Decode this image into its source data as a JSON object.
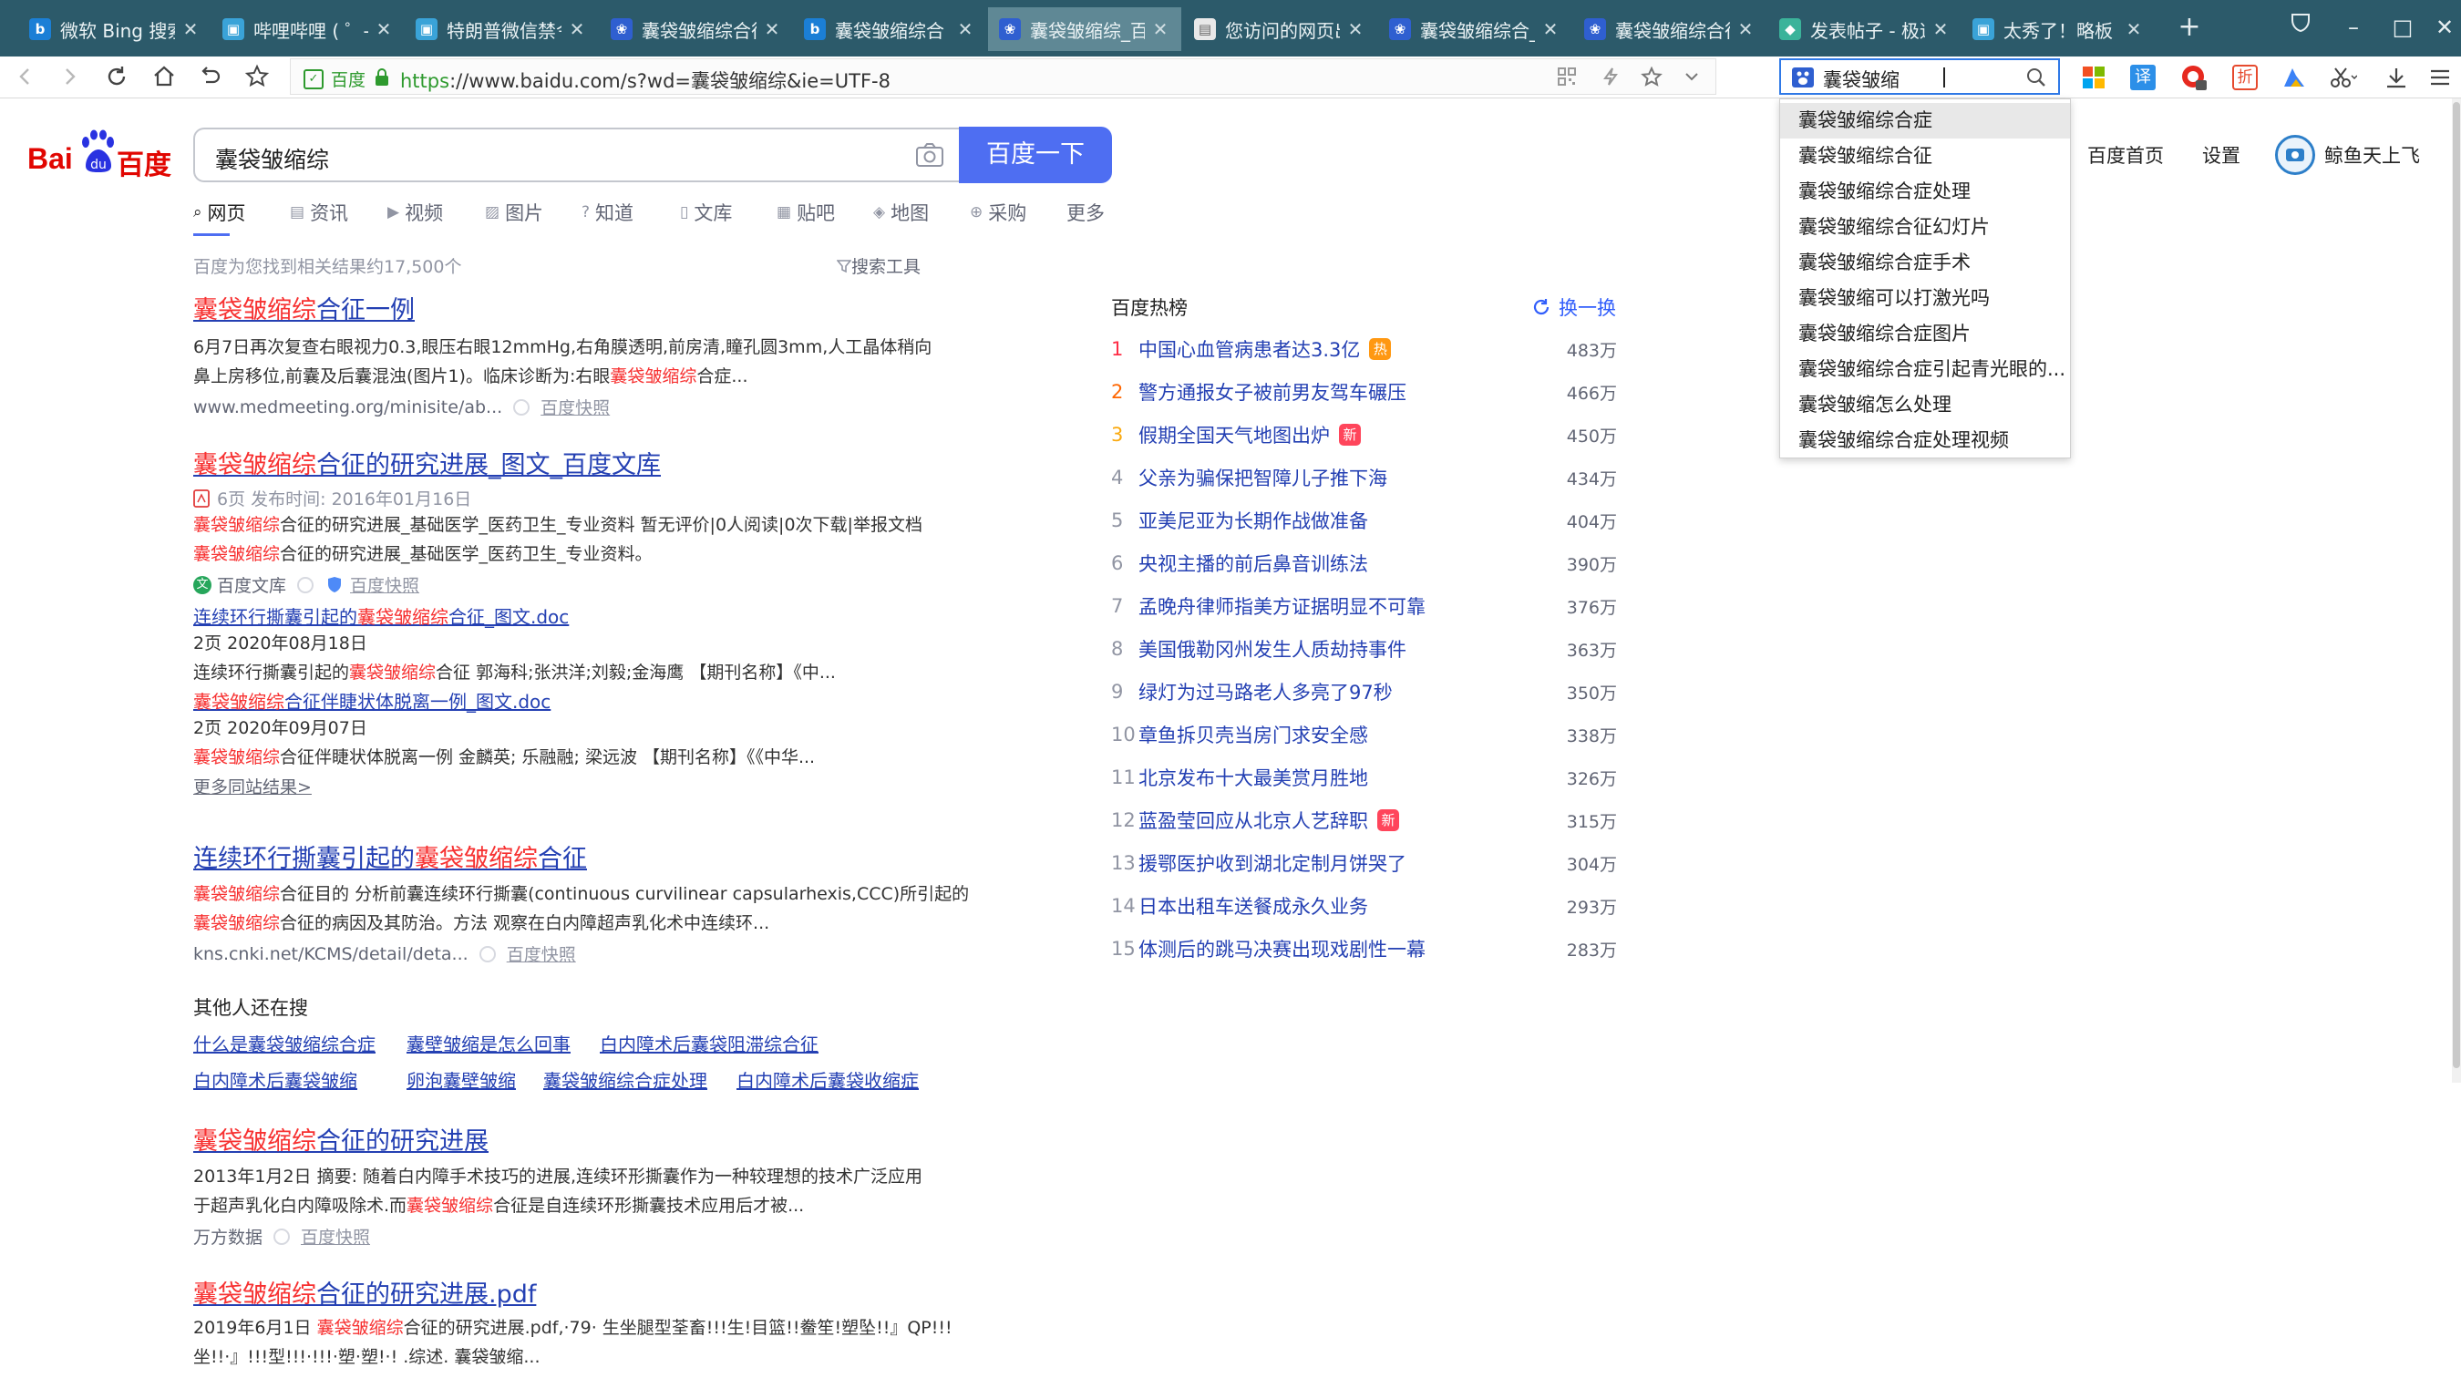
{
  "tabs": [
    {
      "title": "微软 Bing 搜索",
      "icon": "bing-icon",
      "color": "#1b7fd6"
    },
    {
      "title": "哔哩哔哩 ( ゜- ゜",
      "icon": "bilibili-icon",
      "color": "#3aa3d8"
    },
    {
      "title": "特朗普微信禁令",
      "icon": "bilibili-icon",
      "color": "#3aa3d8"
    },
    {
      "title": "囊袋皱缩综合征",
      "icon": "baidu-icon",
      "color": "#2f5fd0"
    },
    {
      "title": "囊袋皱缩综合",
      "icon": "bing-icon",
      "color": "#1b7fd6"
    },
    {
      "title": "囊袋皱缩综_百度",
      "icon": "baidu-icon",
      "color": "#2f5fd0",
      "active": true
    },
    {
      "title": "您访问的网页出",
      "icon": "page-icon",
      "color": "#e8e8e8"
    },
    {
      "title": "囊袋皱缩综合_",
      "icon": "baidu-icon",
      "color": "#2f5fd0"
    },
    {
      "title": "囊袋皱缩综合征",
      "icon": "baidu-icon",
      "color": "#2f5fd0"
    },
    {
      "title": "发表帖子 - 极速",
      "icon": "forum-icon",
      "color": "#3bb39a"
    },
    {
      "title": "太秀了！略板",
      "icon": "bilibili-icon",
      "color": "#3aa3d8"
    }
  ],
  "toolbar": {
    "site_badge": "百度",
    "url_https": "https",
    "url_rest": "://www.baidu.com/s?wd=囊袋皱缩综&ie=UTF-8",
    "search_value": "囊袋皱缩"
  },
  "suggestions": [
    "囊袋皱缩综合症",
    "囊袋皱缩综合征",
    "囊袋皱缩综合症处理",
    "囊袋皱缩综合征幻灯片",
    "囊袋皱缩综合症手术",
    "囊袋皱缩可以打激光吗",
    "囊袋皱缩综合症图片",
    "囊袋皱缩综合症引起青光眼的...",
    "囊袋皱缩怎么处理",
    "囊袋皱缩综合症处理视频"
  ],
  "page": {
    "logo_text_left": "Bai",
    "logo_text_right": "百度",
    "query": "囊袋皱缩综",
    "search_button": "百度一下",
    "home_link": "百度首页",
    "settings_link": "设置",
    "username": "鲸鱼天上飞",
    "nav": [
      "网页",
      "资讯",
      "视频",
      "图片",
      "知道",
      "文库",
      "贴吧",
      "地图",
      "采购",
      "更多"
    ],
    "result_count": "百度为您找到相关结果约17,500个",
    "search_tools": "搜索工具"
  },
  "results": {
    "r1": {
      "title_em": "囊袋皱缩综",
      "title_rest": "合征一例",
      "desc1": "6月7日再次复查右眼视力0.3,眼压右眼12mmHg,右角膜透明,前房清,瞳孔圆3mm,人工晶体稍向",
      "desc2a": "鼻上房移位,前囊及后囊混浊(图片1)。临床诊断为:右眼",
      "desc2em": "囊袋皱缩综",
      "desc2b": "合症...",
      "url": "www.medmeeting.org/minisite/ab...",
      "snapshot": "百度快照"
    },
    "r2": {
      "title_em": "囊袋皱缩综",
      "title_rest": "合征的研究进展_图文_百度文库",
      "meta": "6页 发布时间: 2016年01月16日",
      "desc1em": "囊袋皱缩综",
      "desc1": "合征的研究进展_基础医学_医药卫生_专业资料 暂无评价|0人阅读|0次下载|举报文档",
      "desc2em": "囊袋皱缩综",
      "desc2": "合征的研究进展_基础医学_医药卫生_专业资料。",
      "source": "百度文库",
      "snapshot": "百度快照",
      "sub1_a": "连续环行撕囊引起的",
      "sub1_em": "囊袋皱缩综",
      "sub1_b": "合征_图文.doc",
      "sub1_meta": "2页  2020年08月18日",
      "sub1_desc_a": "连续环行撕囊引起的",
      "sub1_desc_em": "囊袋皱缩综",
      "sub1_desc_b": "合征 郭海科;张洪洋;刘毅;金海鹰 【期刊名称】《中...",
      "sub2_em": "囊袋皱缩综",
      "sub2_b": "合征伴睫状体脱离一例_图文.doc",
      "sub2_meta": "2页  2020年09月07日",
      "sub2_desc_em": "囊袋皱缩综",
      "sub2_desc_b": "合征伴睫状体脱离一例 金麟英; 乐融融; 梁远波 【期刊名称】《《中华...",
      "more": "更多同站结果>"
    },
    "r3": {
      "title_a": "连续环行撕囊引起的",
      "title_em": "囊袋皱缩综",
      "title_b": "合征",
      "desc1": "目的 分析前囊连续环行撕囊(continuous curvilinear capsularhexis,CCC)所引起的",
      "desc1em": "囊袋皱缩综",
      "desc1b": "合征",
      "desc2em": "囊袋皱缩综",
      "desc2": "合征的病因及其防治。方法 观察在白内障超声乳化术中连续环...",
      "url": "kns.cnki.net/KCMS/detail/deta...",
      "snapshot": "百度快照"
    },
    "related_title": "其他人还在搜",
    "related": [
      "什么是囊袋皱缩综合症",
      "囊壁皱缩是怎么回事",
      "白内障术后囊袋阻滞综合征",
      "白内障术后囊袋皱缩",
      "卵泡囊壁皱缩",
      "囊袋皱缩综合症处理",
      "白内障术后囊袋收缩症"
    ],
    "r4": {
      "title_em": "囊袋皱缩综",
      "title_rest": "合征的研究进展",
      "desc1": "2013年1月2日 摘要: 随着白内障手术技巧的进展,连续环形撕囊作为一种较理想的技术广泛应用",
      "desc2a": "于超声乳化白内障吸除术.而",
      "desc2em": "囊袋皱缩综",
      "desc2b": "合征是自连续环形撕囊技术应用后才被...",
      "source": "万方数据",
      "snapshot": "百度快照"
    },
    "r5": {
      "title_em": "囊袋皱缩综",
      "title_rest": "合征的研究进展.pdf",
      "desc1a": "2019年6月1日 ",
      "desc1em": "囊袋皱缩综",
      "desc1b": "合征的研究进展.pdf,·79· 生坐腿型荃畜!!!生!目篮!!鲞笙!塑坠!!』QP!!!",
      "desc2": "坐!!·』!!!型!!!·!!!·塑·塑!·! .综述. 囊袋皱缩..."
    }
  },
  "hot": {
    "title": "百度热榜",
    "refresh": "换一换",
    "items": [
      {
        "rank": "1",
        "text": "中国心血管病患者达3.3亿",
        "tag": "热",
        "tag_color": "#ff9812",
        "count": "483万",
        "rank_color": "#fe2d46"
      },
      {
        "rank": "2",
        "text": "警方通报女子被前男友驾车碾压",
        "tag": "",
        "count": "466万",
        "rank_color": "#f60"
      },
      {
        "rank": "3",
        "text": "假期全国天气地图出炉",
        "tag": "新",
        "tag_color": "#ff455b",
        "count": "450万",
        "rank_color": "#faa90e"
      },
      {
        "rank": "4",
        "text": "父亲为骗保把智障儿子推下海",
        "tag": "",
        "count": "434万"
      },
      {
        "rank": "5",
        "text": "亚美尼亚为长期作战做准备",
        "tag": "",
        "count": "404万"
      },
      {
        "rank": "6",
        "text": "央视主播的前后鼻音训练法",
        "tag": "",
        "count": "390万"
      },
      {
        "rank": "7",
        "text": "孟晚舟律师指美方证据明显不可靠",
        "tag": "",
        "count": "376万"
      },
      {
        "rank": "8",
        "text": "美国俄勒冈州发生人质劫持事件",
        "tag": "",
        "count": "363万"
      },
      {
        "rank": "9",
        "text": "绿灯为过马路老人多亮了97秒",
        "tag": "",
        "count": "350万"
      },
      {
        "rank": "10",
        "text": "章鱼拆贝壳当房门求安全感",
        "tag": "",
        "count": "338万"
      },
      {
        "rank": "11",
        "text": "北京发布十大最美赏月胜地",
        "tag": "",
        "count": "326万"
      },
      {
        "rank": "12",
        "text": "蓝盈莹回应从北京人艺辞职",
        "tag": "新",
        "tag_color": "#ff455b",
        "count": "315万"
      },
      {
        "rank": "13",
        "text": "援鄂医护收到湖北定制月饼哭了",
        "tag": "",
        "count": "304万"
      },
      {
        "rank": "14",
        "text": "日本出租车送餐成永久业务",
        "tag": "",
        "count": "293万"
      },
      {
        "rank": "15",
        "text": "体测后的跳马决赛出现戏剧性一幕",
        "tag": "",
        "count": "283万"
      }
    ]
  }
}
